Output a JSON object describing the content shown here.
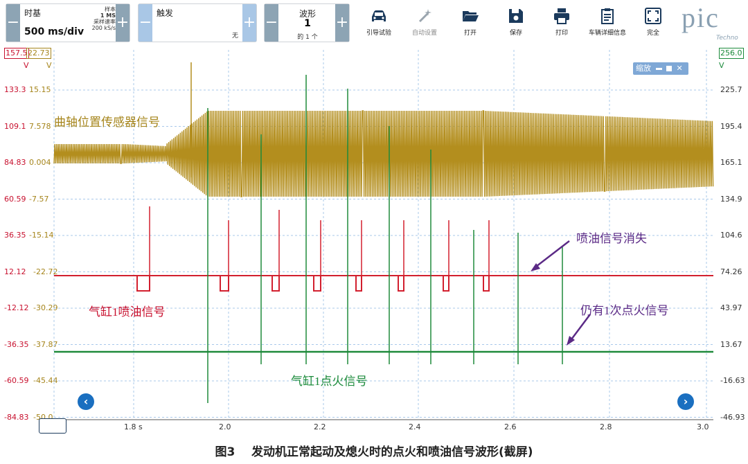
{
  "toolbar": {
    "timebase": {
      "title": "时基",
      "value": "500 ms/div",
      "sample_label": "样本",
      "sample_value": "1 MS",
      "rate_label": "采样速率",
      "rate_value": "200 kS/s"
    },
    "trigger": {
      "title": "触发",
      "value": "无"
    },
    "waveform": {
      "title": "波形",
      "index": "1",
      "count": "的 1 个"
    },
    "buttons": [
      {
        "label": "引导试验",
        "icon": "car-icon",
        "enabled": true
      },
      {
        "label": "自动设置",
        "icon": "magic-wand-icon",
        "enabled": false
      },
      {
        "label": "打开",
        "icon": "folder-open-icon",
        "enabled": true
      },
      {
        "label": "保存",
        "icon": "save-icon",
        "enabled": true
      },
      {
        "label": "打印",
        "icon": "printer-icon",
        "enabled": true
      },
      {
        "label": "车辆详细信息",
        "icon": "clipboard-icon",
        "enabled": true
      },
      {
        "label": "完全",
        "icon": "fullscreen-icon",
        "enabled": true
      }
    ],
    "logo": {
      "text": "pic",
      "sub": "Techno"
    }
  },
  "scope": {
    "zoom_label": "缩放",
    "channels": {
      "A": {
        "color": "#c8102e",
        "top": "157.5",
        "unit": "V",
        "labels": [
          "133.3",
          "109.1",
          "84.83",
          "60.59",
          "36.35",
          "12.12",
          "-12.12",
          "-36.35",
          "-60.59",
          "-84.83"
        ]
      },
      "B": {
        "color": "#a5841a",
        "top": "22.73",
        "unit": "V",
        "labels": [
          "15.15",
          "7.578",
          "0.004",
          "-7.57",
          "-15.14",
          "-22.72",
          "-30.29",
          "-37.87",
          "-45.44",
          "-50.0"
        ]
      },
      "C": {
        "color": "#1a8a3a",
        "top": "256.0",
        "unit": "V",
        "labels": [
          "225.7",
          "195.4",
          "165.1",
          "134.9",
          "104.6",
          "74.26",
          "43.97",
          "13.67",
          "-16.63",
          "-46.93"
        ]
      }
    },
    "x_axis": {
      "labels": [
        "1.8 s",
        "2.0",
        "2.2",
        "2.4",
        "2.6",
        "2.8",
        "3.0"
      ]
    },
    "annotations": {
      "crank": "曲轴位置传感器信号",
      "injector": "气缸1喷油信号",
      "ignition": "气缸1点火信号",
      "inj_missing": "喷油信号消失",
      "ign_remains": "仍有1次点火信号"
    }
  },
  "caption": {
    "fig": "图3",
    "text": "发动机正常起动及熄火时的点火和喷油信号波形(截屏)"
  }
}
